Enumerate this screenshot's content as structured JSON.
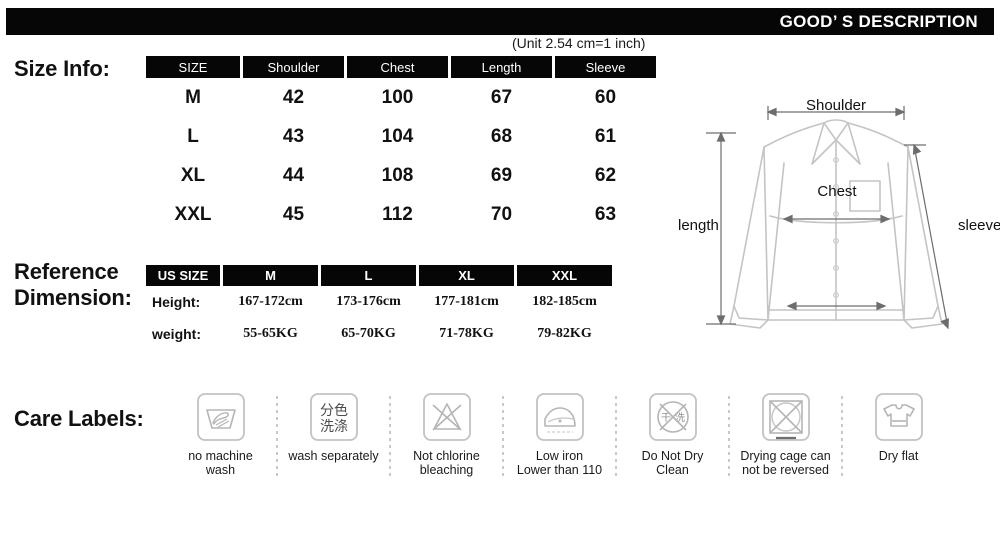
{
  "header": {
    "title": "GOOD’ S DESCRIPTION"
  },
  "unit_note": "(Unit 2.54 cm=1 inch)",
  "sections": {
    "size_info_label": "Size Info:",
    "reference_label_line1": "Reference",
    "reference_label_line2": "Dimension:",
    "care_label": "Care Labels:"
  },
  "size_table": {
    "columns": [
      "SIZE",
      "Shoulder",
      "Chest",
      "Length",
      "Sleeve"
    ],
    "rows": [
      [
        "M",
        "42",
        "100",
        "67",
        "60"
      ],
      [
        "L",
        "43",
        "104",
        "68",
        "61"
      ],
      [
        "XL",
        "44",
        "108",
        "69",
        "62"
      ],
      [
        "XXL",
        "45",
        "112",
        "70",
        "63"
      ]
    ]
  },
  "reference_table": {
    "columns": [
      "US SIZE",
      "M",
      "L",
      "XL",
      "XXL"
    ],
    "rows": [
      [
        "Height:",
        "167-172cm",
        "173-176cm",
        "177-181cm",
        "182-185cm"
      ],
      [
        "weight:",
        "55-65KG",
        "65-70KG",
        "71-78KG",
        "79-82KG"
      ]
    ]
  },
  "garment_diagram": {
    "shoulder_label": "Shoulder",
    "chest_label": "Chest",
    "length_label": "length",
    "sleeve_label": "sleeve"
  },
  "care_labels": [
    {
      "icon": "hand-wash-basin-icon",
      "text": "no machine\nwash"
    },
    {
      "icon": "wash-separately-icon",
      "text": "wash separately",
      "icon_text_line1": "分色",
      "icon_text_line2": "洗涤"
    },
    {
      "icon": "no-chlorine-bleach-icon",
      "text": "Not chlorine\nbleaching"
    },
    {
      "icon": "low-iron-icon",
      "text": "Low iron\nLower than 110"
    },
    {
      "icon": "do-not-dry-clean-icon",
      "text": "Do Not Dry\nClean",
      "icon_text_line1": "干",
      "icon_text_line2": "洗"
    },
    {
      "icon": "no-tumble-dry-icon",
      "text": "Drying cage can\nnot be reversed"
    },
    {
      "icon": "dry-flat-icon",
      "text": "Dry flat"
    }
  ],
  "colors": {
    "bar_black": "#060606",
    "text_black": "#111111",
    "icon_gray": "#b8b8b8",
    "separator_gray": "#c9c9c9"
  }
}
